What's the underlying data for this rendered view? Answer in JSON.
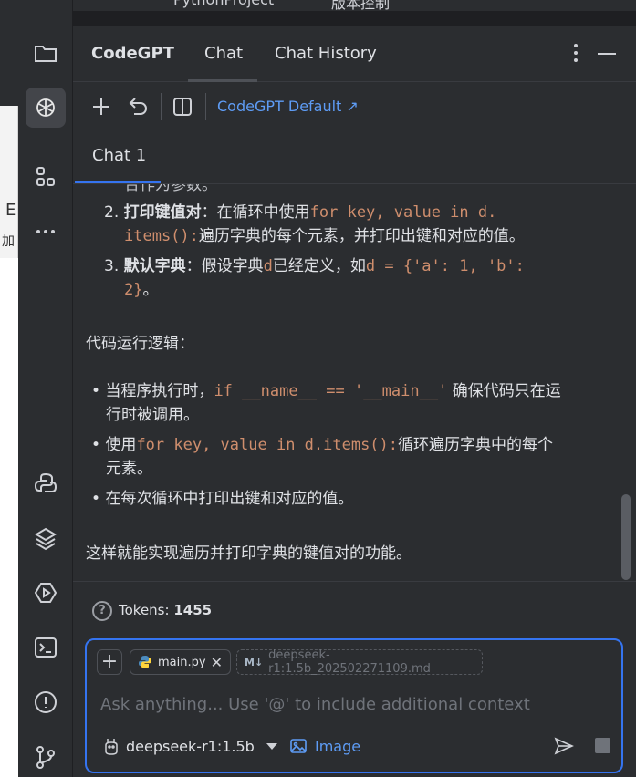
{
  "top_sliver": {
    "project": "PythonProject",
    "branch": "版本控制"
  },
  "left_window": {
    "text1": "E",
    "text2": "加"
  },
  "activity_bar": {
    "items": [
      {
        "name": "folder-icon"
      },
      {
        "name": "codegpt-icon",
        "active": true
      },
      {
        "name": "plugins-icon"
      },
      {
        "name": "more-icon"
      },
      {
        "name": "python-icon"
      },
      {
        "name": "layers-icon"
      },
      {
        "name": "run-icon"
      },
      {
        "name": "terminal-icon"
      },
      {
        "name": "problems-icon"
      },
      {
        "name": "git-icon"
      }
    ]
  },
  "header": {
    "brand": "CodeGPT",
    "tabs": [
      {
        "label": "Chat",
        "active": true
      },
      {
        "label": "Chat History"
      }
    ]
  },
  "toolbar": {
    "model_link": "CodeGPT Default ↗"
  },
  "chat_tab": {
    "label": "Chat 1"
  },
  "messages": {
    "list_top_fragment": "合作为参数。",
    "items": [
      {
        "num": "2.",
        "bold": "打印键值对",
        "sep": "：在循环中使用",
        "code1": "for key, value in d.",
        "code2": "items():",
        "rest": "遍历字典的每个元素，并打印出键和对应的值。"
      },
      {
        "num": "3.",
        "bold": "默认字典",
        "sep": "：假设字典",
        "code1": "d",
        "mid": "已经定义，如",
        "code2": "d = {'a': 1, 'b':",
        "code3": "2}",
        "end": "。"
      }
    ],
    "logic_heading": "代码运行逻辑：",
    "bullets": [
      {
        "pre": "当程序执行时，",
        "code": "if __name__ == '__main__'",
        "post1": "确保代码只在运",
        "post2": "行时被调用。"
      },
      {
        "pre": "使用",
        "code": "for key, value in d.items():",
        "post1": "循环遍历字典中的每个",
        "post2": "元素。"
      },
      {
        "pre": "在每次循环中打印出键和对应的值。"
      }
    ],
    "conclusion": "这样就能实现遍历并打印字典的键值对的功能。"
  },
  "tokens": {
    "label": "Tokens: ",
    "value": "1455"
  },
  "input": {
    "file_chip": "main.py",
    "md_chip_badge": "M↓",
    "md_chip": "deepseek-r1:1.5b_202502271109.md",
    "placeholder": "Ask anything... Use '@' to include additional context",
    "model": "deepseek-r1:1.5b",
    "image_label": "Image"
  },
  "colors": {
    "accent": "#3574f0",
    "link": "#5e9cf5",
    "code": "#cf8e6d",
    "panel": "#2b2d30"
  }
}
